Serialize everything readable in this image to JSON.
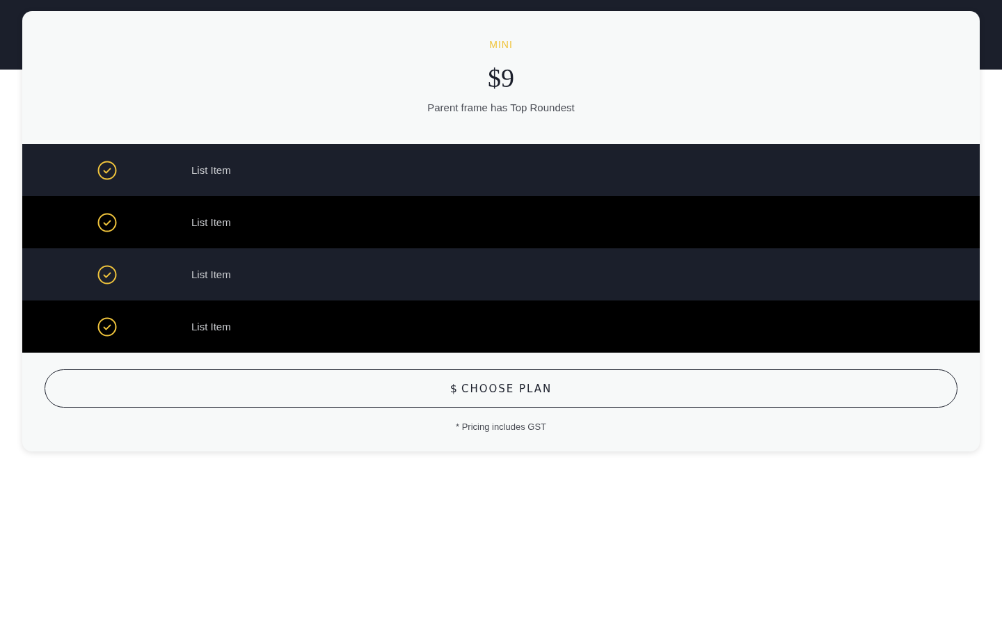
{
  "plan": {
    "name": "MINI",
    "price": "$9",
    "subtitle": "Parent frame has Top Roundest"
  },
  "features": [
    {
      "label": "List Item"
    },
    {
      "label": "List Item"
    },
    {
      "label": "List Item"
    },
    {
      "label": "List Item"
    }
  ],
  "button": {
    "icon": "$",
    "label": "CHOOSE PLAN"
  },
  "note": "* Pricing includes GST"
}
